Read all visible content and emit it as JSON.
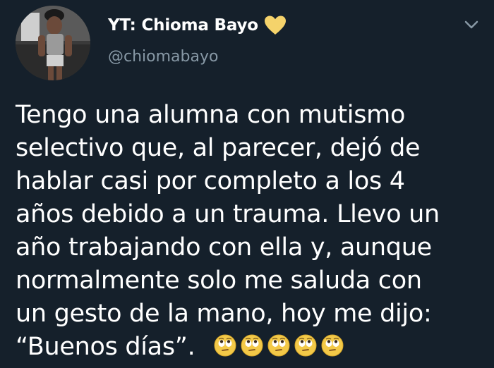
{
  "tweet": {
    "display_name": "YT: Chioma Bayo",
    "name_badge_icon": "yellow-heart-icon",
    "handle": "@chiomabayo",
    "menu_icon": "chevron-down-icon",
    "text_lines": [
      "Tengo una alumna con mutismo",
      "selectivo que, al parecer, dejó de",
      "hablar casi por completo a los 4",
      "años debido a un trauma. Llevo un",
      "año trabajando con ella y, aunque",
      "normalmente solo me saluda con",
      "un gesto de la mano, hoy me dijo:",
      "“Buenos días”."
    ],
    "trailing_emoji": "face-with-rolling-eyes-icon",
    "trailing_emoji_count": 5
  },
  "colors": {
    "background": "#15202b",
    "text": "#ffffff",
    "secondary_text": "#8899a6",
    "heart": "#f5d36b",
    "emoji": "#f3c948"
  }
}
